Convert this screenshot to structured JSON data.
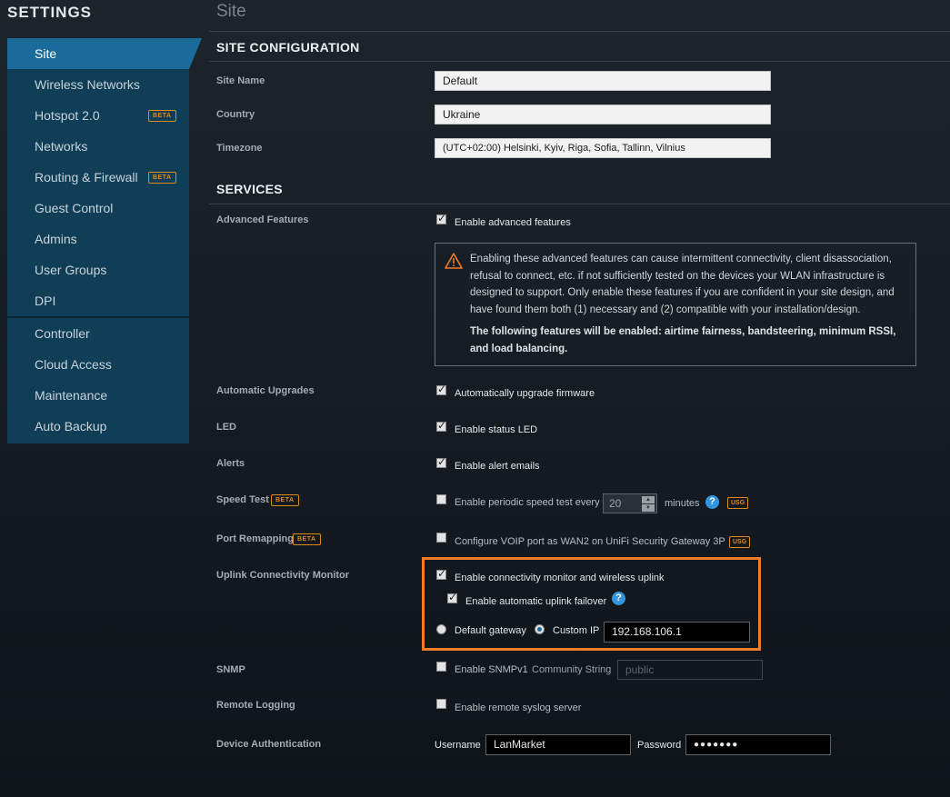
{
  "sidebar": {
    "title": "SETTINGS",
    "items": [
      {
        "label": "Site"
      },
      {
        "label": "Wireless Networks"
      },
      {
        "label": "Hotspot 2.0",
        "badge": "BETA"
      },
      {
        "label": "Networks"
      },
      {
        "label": "Routing & Firewall",
        "badge": "BETA"
      },
      {
        "label": "Guest Control"
      },
      {
        "label": "Admins"
      },
      {
        "label": "User Groups"
      },
      {
        "label": "DPI"
      },
      {
        "label": "Controller"
      },
      {
        "label": "Cloud Access"
      },
      {
        "label": "Maintenance"
      },
      {
        "label": "Auto Backup"
      }
    ]
  },
  "page": {
    "title": "Site"
  },
  "site_config": {
    "heading": "SITE CONFIGURATION",
    "site_name_label": "Site Name",
    "site_name_value": "Default",
    "country_label": "Country",
    "country_value": "Ukraine",
    "timezone_label": "Timezone",
    "timezone_value": "(UTC+02:00) Helsinki, Kyiv, Riga, Sofia, Tallinn, Vilnius"
  },
  "services": {
    "heading": "SERVICES",
    "advanced": {
      "label": "Advanced Features",
      "checkbox": "Enable advanced features",
      "warning": "Enabling these advanced features can cause intermittent connectivity, client disassociation, refusal to connect, etc. if not sufficiently tested on the devices your WLAN infrastructure is designed to support. Only enable these features if you are confident in your site design, and have found them both (1) necessary and (2) compatible with your installation/design.",
      "warning_bold": "The following features will be enabled: airtime fairness, bandsteering, minimum RSSI, and load balancing."
    },
    "upgrades": {
      "label": "Automatic Upgrades",
      "checkbox": "Automatically upgrade firmware"
    },
    "led": {
      "label": "LED",
      "checkbox": "Enable status LED"
    },
    "alerts": {
      "label": "Alerts",
      "checkbox": "Enable alert emails"
    },
    "speed_test": {
      "label": "Speed Test",
      "badge": "BETA",
      "checkbox": "Enable periodic speed test every",
      "value": "20",
      "unit": "minutes",
      "help": "?",
      "tag": "USG"
    },
    "port_remap": {
      "label": "Port Remapping",
      "badge": "BETA",
      "checkbox": "Configure VOIP port as WAN2 on UniFi Security Gateway 3P",
      "tag": "USG"
    },
    "uplink": {
      "label": "Uplink Connectivity Monitor",
      "checkbox": "Enable connectivity monitor and wireless uplink",
      "failover": "Enable automatic uplink failover",
      "help": "?",
      "default_gateway": "Default gateway",
      "custom_ip_label": "Custom IP",
      "custom_ip_value": "192.168.106.1"
    },
    "snmp": {
      "label": "SNMP",
      "checkbox": "Enable SNMPv1",
      "community_label": "Community String",
      "community_placeholder": "public"
    },
    "remote_logging": {
      "label": "Remote Logging",
      "checkbox": "Enable remote syslog server"
    },
    "device_auth": {
      "label": "Device Authentication",
      "username_label": "Username",
      "username_value": "LanMarket",
      "password_label": "Password",
      "password_value": "●●●●●●●"
    }
  },
  "colors": {
    "accent": "#1a6b99",
    "sidebar": "#113e57",
    "highlight": "#f07b28",
    "badge": "#e08a1c"
  }
}
